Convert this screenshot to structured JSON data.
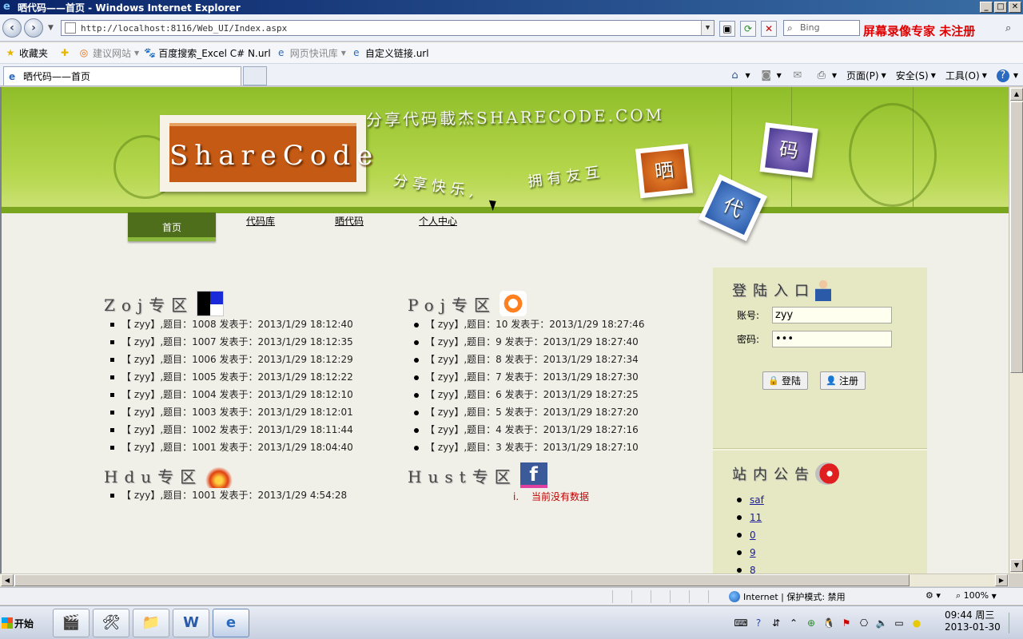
{
  "window": {
    "title": "晒代码——首页 - Windows Internet Explorer",
    "min": "_",
    "max": "□",
    "close": "✕"
  },
  "address": {
    "url": "http://localhost:8116/Web_UI/Index.aspx",
    "search_placeholder": "Bing",
    "watermark": "屏幕录像专家  未注册"
  },
  "favorites": {
    "items": [
      {
        "label": "收藏夹"
      },
      {
        "label": "建议网站"
      },
      {
        "label": "百度搜索_Excel C# N.url"
      },
      {
        "label": "网页快讯库"
      },
      {
        "label": "自定义链接.url"
      }
    ]
  },
  "tab": {
    "label": "晒代码——首页"
  },
  "commandbar": {
    "page": "页面(P)",
    "safety": "安全(S)",
    "tools": "工具(O)",
    "help": "?"
  },
  "banner": {
    "logo": "ShareCode",
    "slogan_top": "分享代码載杰SHARECODE.COM",
    "slogan_a": "分享快乐,",
    "slogan_b": "拥有友互",
    "photo_shai": "晒",
    "photo_ma": "码",
    "photo_dai": "代"
  },
  "menu": {
    "items": [
      {
        "label": "首页"
      },
      {
        "label": "代码库"
      },
      {
        "label": "晒代码"
      },
      {
        "label": "个人中心"
      }
    ]
  },
  "sections": {
    "zoj": {
      "title": "Zoj专区",
      "items": [
        "【 zyy】,题目：1008 发表于：2013/1/29 18:12:40",
        "【 zyy】,题目：1007 发表于：2013/1/29 18:12:35",
        "【 zyy】,题目：1006 发表于：2013/1/29 18:12:29",
        "【 zyy】,题目：1005 发表于：2013/1/29 18:12:22",
        "【 zyy】,题目：1004 发表于：2013/1/29 18:12:10",
        "【 zyy】,题目：1003 发表于：2013/1/29 18:12:01",
        "【 zyy】,题目：1002 发表于：2013/1/29 18:11:44",
        "【 zyy】,题目：1001 发表于：2013/1/29 18:04:40"
      ]
    },
    "poj": {
      "title": "Poj专区",
      "items": [
        "【 zyy】,题目：10 发表于：2013/1/29 18:27:46",
        "【 zyy】,题目：9 发表于：2013/1/29 18:27:40",
        "【 zyy】,题目：8 发表于：2013/1/29 18:27:34",
        "【 zyy】,题目：7 发表于：2013/1/29 18:27:30",
        "【 zyy】,题目：6 发表于：2013/1/29 18:27:25",
        "【 zyy】,题目：5 发表于：2013/1/29 18:27:20",
        "【 zyy】,题目：4 发表于：2013/1/29 18:27:16",
        "【 zyy】,题目：3 发表于：2013/1/29 18:27:10"
      ]
    },
    "hdu": {
      "title": "Hdu专区",
      "items": [
        "【 zyy】,题目：1001 发表于：2013/1/29 4:54:28"
      ]
    },
    "hust": {
      "title": "Hust专区",
      "icon_letter": "f",
      "empty_num": "i.",
      "empty_text": "当前没有数据"
    }
  },
  "login": {
    "title": "登陆入口",
    "account_label": "账号:",
    "account_value": "zyy",
    "password_label": "密码:",
    "password_value": "•••",
    "login_button": "登陆",
    "register_button": "注册"
  },
  "notice": {
    "title": "站内公告",
    "items": [
      "saf",
      "11",
      "0",
      "9",
      "8"
    ]
  },
  "statusbar": {
    "zone": "Internet | 保护模式: 禁用",
    "zoom": "100%"
  },
  "taskbar": {
    "start": "开始",
    "time": "09:44 周三",
    "date": "2013-01-30"
  },
  "colors": {
    "banner_green": "#a4cc3c",
    "menu_active": "#4f6e1c",
    "sidebar_bg": "#e6e8c4",
    "nodata_red": "#c00000",
    "watermark_red": "#e00000"
  }
}
